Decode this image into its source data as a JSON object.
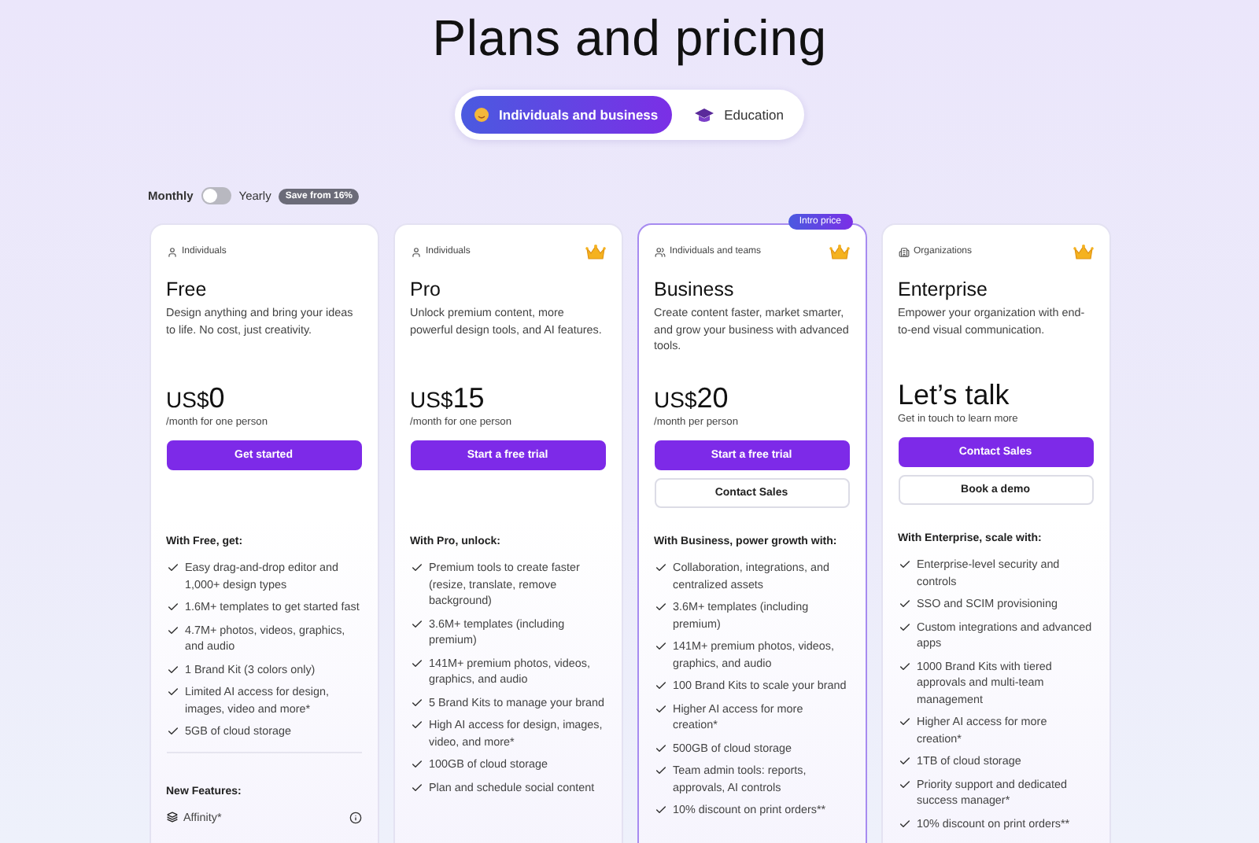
{
  "title": "Plans and pricing",
  "segments": [
    {
      "label": "Individuals and business",
      "kind": "business",
      "selected": true
    },
    {
      "label": "Education",
      "kind": "education",
      "selected": false
    }
  ],
  "billing": {
    "monthly_label": "Monthly",
    "yearly_label": "Yearly",
    "yearly": false,
    "save_badge": "Save from 16%"
  },
  "plans": [
    {
      "kind": "individual",
      "audience": "Individuals",
      "premium": false,
      "highlighted": false,
      "name": "Free",
      "description": "Design anything and bring your ideas to life. No cost, just creativity.",
      "price": "US$",
      "amount": "0",
      "price_note": "/month for one person",
      "buttons": [
        {
          "label": "Get started",
          "kind": "primary"
        }
      ],
      "features_heading": "With Free, get:",
      "features": [
        "Easy drag-and-drop editor and 1,000+ design types",
        "1.6M+ templates to get started fast",
        "4.7M+ photos, videos, graphics, and audio",
        "1 Brand Kit (3 colors only)",
        "Limited AI access for design, images, video and more*",
        "5GB of cloud storage"
      ],
      "new_features_heading": "New Features:",
      "new_features": [
        {
          "label": "Affinity*",
          "info": true
        }
      ]
    },
    {
      "kind": "individual",
      "audience": "Individuals",
      "premium": true,
      "highlighted": false,
      "name": "Pro",
      "description": "Unlock premium content, more powerful design tools, and AI features.",
      "price": "US$",
      "amount": "15",
      "price_note": "/month for one person",
      "buttons": [
        {
          "label": "Start a free trial",
          "kind": "primary"
        }
      ],
      "features_heading": "With Pro, unlock:",
      "features": [
        "Premium tools to create faster (resize, translate, remove background)",
        "3.6M+ templates (including premium)",
        "141M+ premium photos, videos, graphics, and audio",
        "5 Brand Kits to manage your brand",
        "High AI access for design, images, video, and more*",
        "100GB of cloud storage",
        "Plan and schedule social content"
      ]
    },
    {
      "kind": "team",
      "audience": "Individuals and teams",
      "premium": true,
      "highlighted": true,
      "badge": "Intro price",
      "name": "Business",
      "description": "Create content faster, market smarter, and grow your business with advanced tools.",
      "price": "US$",
      "amount": "20",
      "price_note": "/month per person",
      "buttons": [
        {
          "label": "Start a free trial",
          "kind": "primary"
        },
        {
          "label": "Contact Sales",
          "kind": "secondary"
        }
      ],
      "features_heading": "With Business, power growth with:",
      "features": [
        "Collaboration, integrations, and centralized assets",
        "3.6M+ templates (including premium)",
        "141M+ premium photos, videos, graphics, and audio",
        "100 Brand Kits to scale your brand",
        "Higher AI access for more creation*",
        "500GB of cloud storage",
        "Team admin tools: reports, approvals, AI controls",
        "10% discount on print orders**"
      ]
    },
    {
      "kind": "organization",
      "audience": "Organizations",
      "premium": true,
      "highlighted": false,
      "name": "Enterprise",
      "description": "Empower your organization with end-to-end visual communication.",
      "price_text": "Let’s talk",
      "price_note": "Get in touch to learn more",
      "buttons": [
        {
          "label": "Contact Sales",
          "kind": "primary"
        },
        {
          "label": "Book a demo",
          "kind": "secondary"
        }
      ],
      "features_heading": "With Enterprise, scale with:",
      "features": [
        "Enterprise-level security and controls",
        "SSO and SCIM provisioning",
        "Custom integrations and advanced apps",
        "1000 Brand Kits with tiered approvals and multi-team management",
        "Higher AI access for more creation*",
        "1TB of cloud storage",
        "Priority support and dedicated success manager*",
        "10% discount on print orders**"
      ]
    }
  ]
}
